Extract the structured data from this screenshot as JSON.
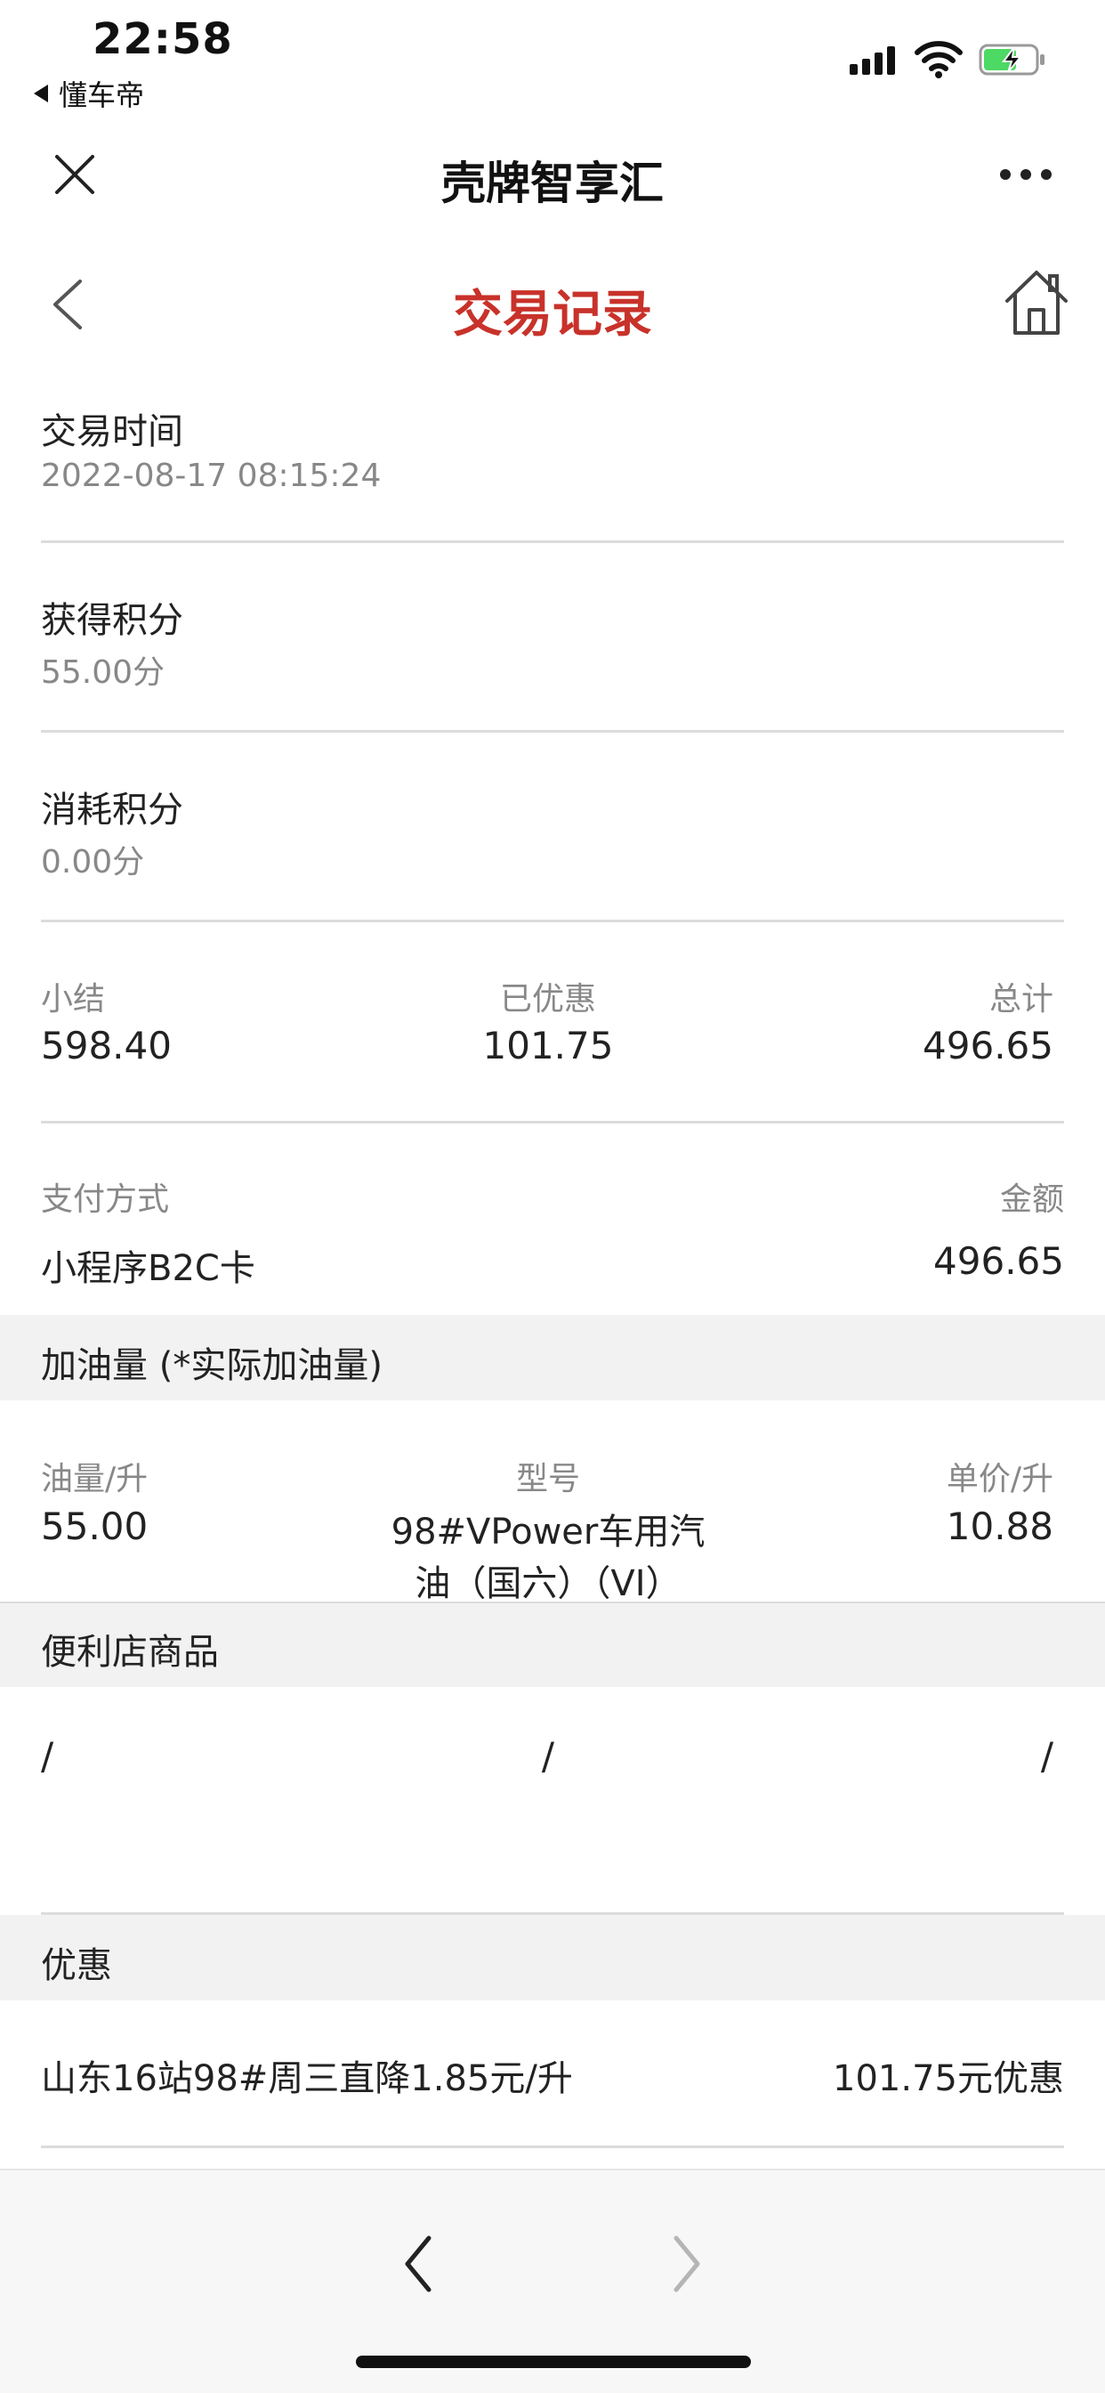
{
  "status": {
    "time": "22:58",
    "back_app": "懂车帝"
  },
  "miniprogram": {
    "title": "壳牌智享汇"
  },
  "page": {
    "title": "交易记录",
    "accent_color": "#c8322a"
  },
  "transaction": {
    "time_label": "交易时间",
    "time_value": "2022-08-17 08:15:24",
    "earned_label": "获得积分",
    "earned_value": "55.00分",
    "used_label": "消耗积分",
    "used_value": "0.00分"
  },
  "totals": {
    "subtotal_label": "小结",
    "subtotal_value": "598.40",
    "discount_label": "已优惠",
    "discount_value": "101.75",
    "total_label": "总计",
    "total_value": "496.65"
  },
  "payment": {
    "method_label": "支付方式",
    "amount_label": "金额",
    "method_value": "小程序B2C卡",
    "amount_value": "496.65"
  },
  "fuel": {
    "section_title": "加油量 (*实际加油量)",
    "volume_label": "油量/升",
    "model_label": "型号",
    "unit_price_label": "单价/升",
    "volume_value": "55.00",
    "model_value_line1": "98#VPower车用汽",
    "model_value_line2": "油（国六）（VI）",
    "unit_price_value": "10.88"
  },
  "store": {
    "section_title": "便利店商品",
    "col1": "/",
    "col2": "/",
    "col3": "/"
  },
  "promo": {
    "section_title": "优惠",
    "name": "山东16站98#周三直降1.85元/升",
    "amount": "101.75元优惠"
  }
}
